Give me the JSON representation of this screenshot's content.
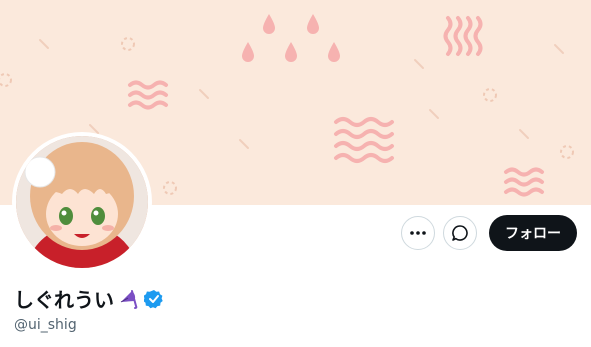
{
  "profile": {
    "display_name": "しぐれうい",
    "handle": "@ui_shig",
    "verified": true,
    "name_icon": "umbrella-icon"
  },
  "actions": {
    "more_icon": "more-icon",
    "message_icon": "message-icon",
    "follow_label": "フォロー"
  },
  "colors": {
    "banner_background": "#fbe9dc",
    "banner_pattern": "#f6b2b0",
    "follow_button": "#0f1419",
    "verified_badge": "#1d9bf0",
    "handle_text": "#536471"
  }
}
